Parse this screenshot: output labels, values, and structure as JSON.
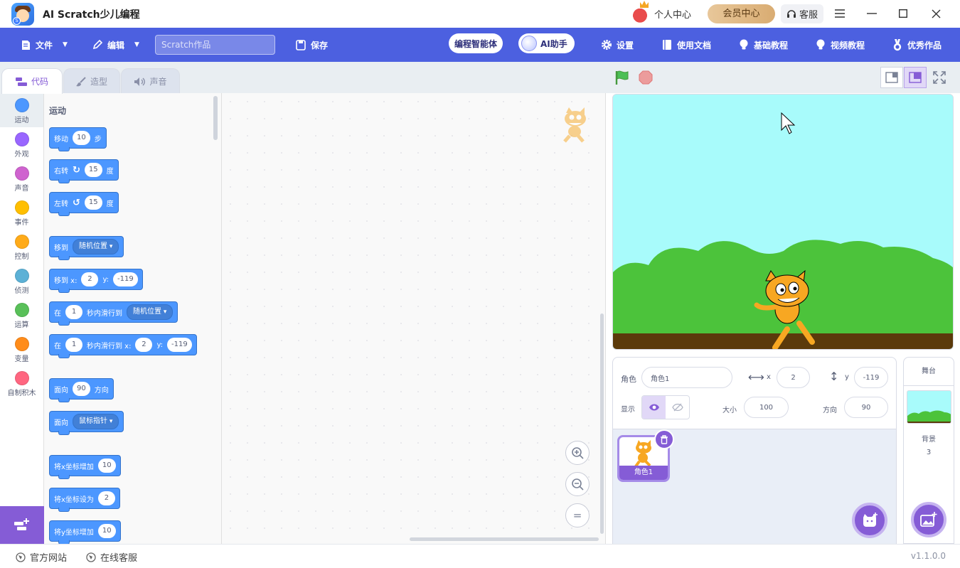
{
  "window": {
    "title": "AI Scratch少儿编程"
  },
  "titlebar": {
    "user_center": "个人中心",
    "vip_center": "会员中心",
    "customer_service": "客服"
  },
  "menubar": {
    "file": "文件",
    "edit": "编辑",
    "project_placeholder": "Scratch作品",
    "save": "保存",
    "ai_agent": "编程智能体",
    "ai_helper": "AI助手",
    "settings": "设置",
    "docs": "使用文档",
    "basic_tutorial": "基础教程",
    "video_tutorial": "视频教程",
    "showcase": "优秀作品"
  },
  "tabs": {
    "code": "代码",
    "costumes": "造型",
    "sounds": "声音"
  },
  "categories": [
    {
      "label": "运动",
      "color": "#4c97ff"
    },
    {
      "label": "外观",
      "color": "#9966ff"
    },
    {
      "label": "声音",
      "color": "#cf63cf"
    },
    {
      "label": "事件",
      "color": "#ffbf00"
    },
    {
      "label": "控制",
      "color": "#ffab19"
    },
    {
      "label": "侦测",
      "color": "#5cb1d6"
    },
    {
      "label": "运算",
      "color": "#59c059"
    },
    {
      "label": "变量",
      "color": "#ff8c1a"
    },
    {
      "label": "自制积木",
      "color": "#ff6680"
    }
  ],
  "palette": {
    "section_title": "运动",
    "move": {
      "t1": "移动",
      "v": "10",
      "t2": "步"
    },
    "turn_right": {
      "t1": "右转",
      "v": "15",
      "t2": "度"
    },
    "turn_left": {
      "t1": "左转",
      "v": "15",
      "t2": "度"
    },
    "goto": {
      "t1": "移到",
      "dd": "随机位置"
    },
    "goto_xy": {
      "t1": "移到 x:",
      "x": "2",
      "t2": "y:",
      "y": "-119"
    },
    "glide": {
      "t1": "在",
      "v": "1",
      "t2": "秒内滑行到",
      "dd": "随机位置"
    },
    "glide_xy": {
      "t1": "在",
      "v": "1",
      "t2": "秒内滑行到 x:",
      "x": "2",
      "t3": "y:",
      "y": "-119"
    },
    "point_dir": {
      "t1": "面向",
      "v": "90",
      "t2": "方向"
    },
    "point_towards": {
      "t1": "面向",
      "dd": "鼠标指针"
    },
    "change_x": {
      "t1": "将x坐标增加",
      "v": "10"
    },
    "set_x": {
      "t1": "将x坐标设为",
      "v": "2"
    },
    "change_y": {
      "t1": "将y坐标增加",
      "v": "10"
    }
  },
  "zoom": {
    "reset": "="
  },
  "sprite_info": {
    "sprite_label": "角色",
    "sprite_name": "角色1",
    "x_label": "x",
    "x_value": "2",
    "y_label": "y",
    "y_value": "-119",
    "show_label": "显示",
    "size_label": "大小",
    "size_value": "100",
    "direction_label": "方向",
    "direction_value": "90"
  },
  "sprites": [
    {
      "name": "角色1"
    }
  ],
  "stage_panel": {
    "header": "舞台",
    "backdrops_label": "背景",
    "backdrops_count": "3"
  },
  "statusbar": {
    "official_site": "官方网站",
    "online_service": "在线客服",
    "version": "v1.1.0.0"
  },
  "colors": {
    "brand": "#4c60e0",
    "accent": "#855cd6",
    "motion": "#4c97ff"
  }
}
